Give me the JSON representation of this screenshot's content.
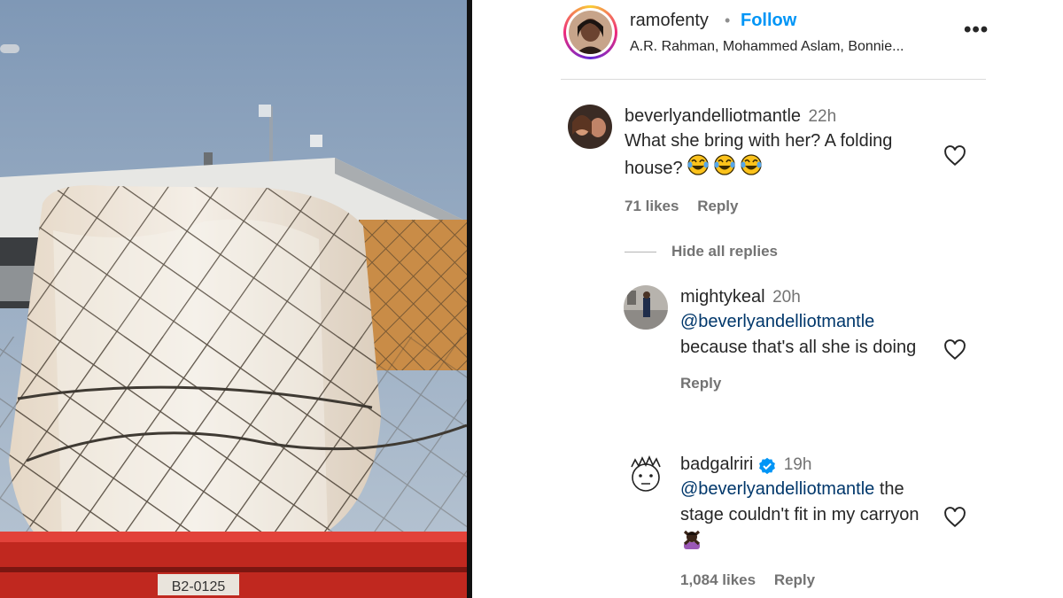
{
  "photo": {
    "truck_plate": "B2-0125"
  },
  "post": {
    "owner_username": "ramofenty",
    "follow_label": "Follow",
    "audio_credits": "A.R. Rahman, Mohammed Aslam, Bonnie..."
  },
  "comments": [
    {
      "username": "beverlyandelliotmantle",
      "time": "22h",
      "text": "What she bring with her? A folding house?",
      "emojis": [
        "face-with-tears-of-joy",
        "face-with-tears-of-joy",
        "face-with-tears-of-joy"
      ],
      "likes": "71 likes",
      "reply_label": "Reply",
      "replies_toggle": "Hide all replies"
    },
    {
      "username": "mightykeal",
      "time": "20h",
      "mention": "@beverlyandelliotmantle",
      "text": "because that's all she is doing",
      "reply_label": "Reply"
    },
    {
      "username": "badgalriri",
      "verified": true,
      "time": "19h",
      "mention": "@beverlyandelliotmantle",
      "text_after_mention": "the",
      "text": "stage couldn't fit in my carryon",
      "emojis": [
        "person-gesturing-no"
      ],
      "likes": "1,084 likes",
      "reply_label": "Reply"
    }
  ],
  "colors": {
    "follow": "#0095f6",
    "mention": "#00376b",
    "meta_gray": "#737373",
    "verified": "#0095f6"
  }
}
